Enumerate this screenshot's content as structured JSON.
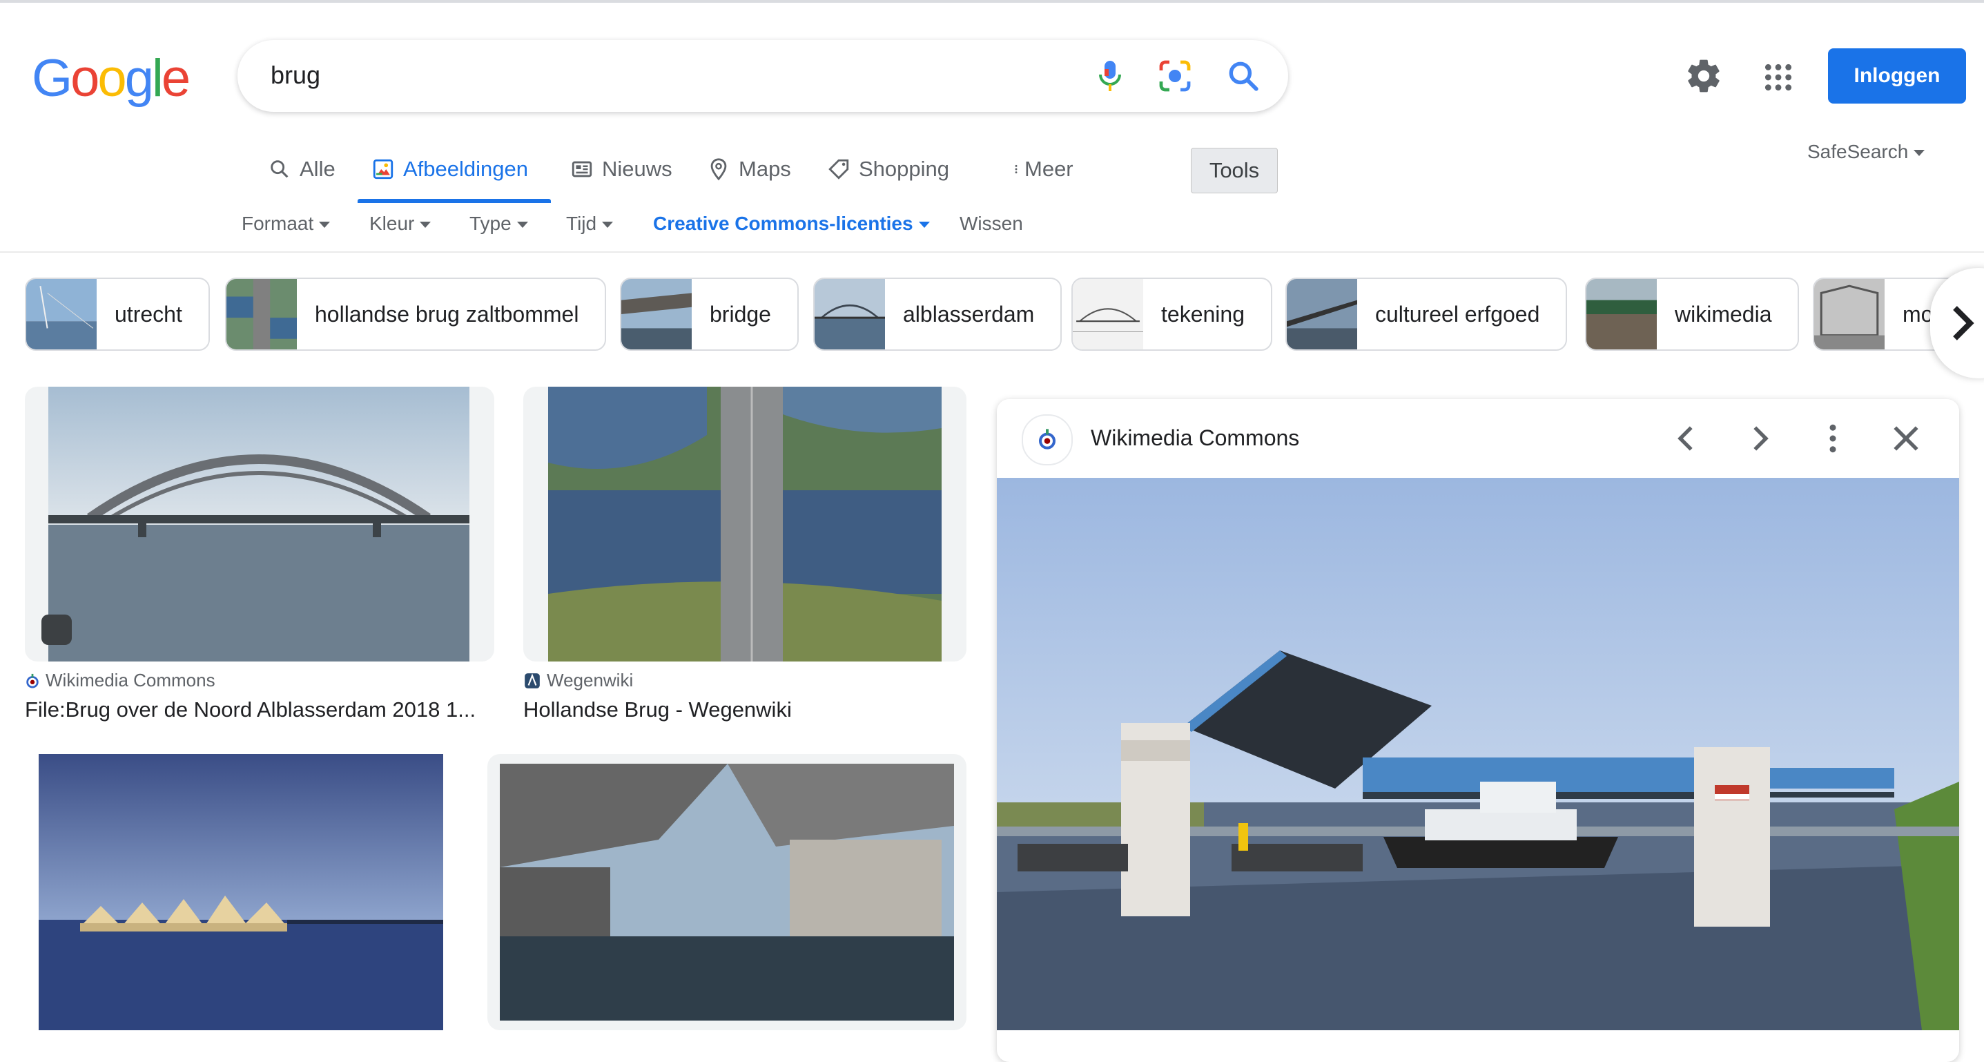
{
  "header": {
    "logo_letters": [
      {
        "char": "G",
        "color": "#4285f4"
      },
      {
        "char": "o",
        "color": "#ea4335"
      },
      {
        "char": "o",
        "color": "#fbbc05"
      },
      {
        "char": "g",
        "color": "#4285f4"
      },
      {
        "char": "l",
        "color": "#34a853"
      },
      {
        "char": "e",
        "color": "#ea4335"
      }
    ],
    "search_query": "brug",
    "login_label": "Inloggen",
    "accent_color": "#1a73e8",
    "icons": [
      "mic-icon",
      "camera-lens-icon",
      "search-icon",
      "gear-icon",
      "apps-grid-icon"
    ]
  },
  "tabs": [
    {
      "label": "Alle",
      "icon": "search-icon",
      "active": false
    },
    {
      "label": "Afbeeldingen",
      "icon": "image-icon",
      "active": true
    },
    {
      "label": "Nieuws",
      "icon": "news-icon",
      "active": false
    },
    {
      "label": "Maps",
      "icon": "map-pin-icon",
      "active": false
    },
    {
      "label": "Shopping",
      "icon": "tag-icon",
      "active": false
    },
    {
      "label": "Meer",
      "icon": "more-vert-icon",
      "active": false
    }
  ],
  "tools_label": "Tools",
  "safesearch_label": "SafeSearch",
  "filters": [
    {
      "label": "Formaat",
      "dropdown": true
    },
    {
      "label": "Kleur",
      "dropdown": true
    },
    {
      "label": "Type",
      "dropdown": true
    },
    {
      "label": "Tijd",
      "dropdown": true
    },
    {
      "label": "Creative Commons-licenties",
      "dropdown": true,
      "active": true
    },
    {
      "label": "Wissen",
      "dropdown": false
    }
  ],
  "chips": [
    {
      "label": "utrecht"
    },
    {
      "label": "hollandse brug zaltbommel"
    },
    {
      "label": "bridge"
    },
    {
      "label": "alblasserdam"
    },
    {
      "label": "tekening"
    },
    {
      "label": "cultureel erfgoed"
    },
    {
      "label": "wikimedia"
    },
    {
      "label": "mo"
    }
  ],
  "results": [
    {
      "source": "Wikimedia Commons",
      "title": "File:Brug over de Noord Alblasserdam 2018 1..."
    },
    {
      "source": "Wegenwiki",
      "title": "Hollandse Brug - Wegenwiki"
    }
  ],
  "preview": {
    "source": "Wikimedia Commons",
    "controls": [
      "chevron-left-icon",
      "chevron-right-icon",
      "more-vert-icon",
      "close-icon"
    ]
  }
}
